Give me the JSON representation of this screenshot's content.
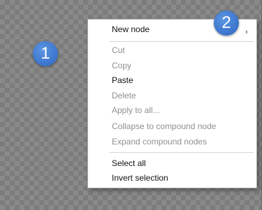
{
  "badges": {
    "first": "1",
    "second": "2"
  },
  "context_menu": {
    "items": [
      {
        "label": "New node",
        "enabled": true,
        "submenu_arrow": "›"
      },
      {
        "label": "Cut",
        "enabled": false
      },
      {
        "label": "Copy",
        "enabled": false
      },
      {
        "label": "Paste",
        "enabled": true
      },
      {
        "label": "Delete",
        "enabled": false
      },
      {
        "label": "Apply to all...",
        "enabled": false
      },
      {
        "label": "Collapse to compound node",
        "enabled": false
      },
      {
        "label": "Expand compound nodes",
        "enabled": false
      },
      {
        "label": "Select all",
        "enabled": true
      },
      {
        "label": "Invert selection",
        "enabled": true
      }
    ]
  },
  "colors": {
    "badge": "#3f78cf",
    "enabled_text": "#111111",
    "disabled_text": "#8f8f8f"
  }
}
